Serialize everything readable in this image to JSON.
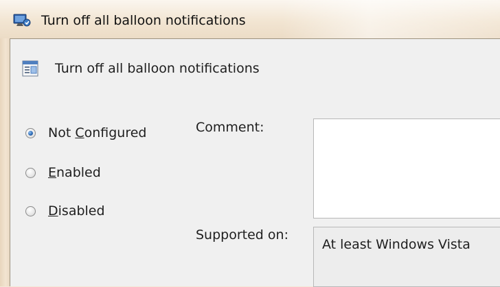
{
  "window": {
    "title": "Turn off all balloon notifications",
    "icon": "policy-window-icon"
  },
  "setting": {
    "title": "Turn off all balloon notifications",
    "icon": "policy-setting-icon"
  },
  "options": [
    {
      "pre": "Not ",
      "accel": "C",
      "post": "onfigured",
      "checked": true
    },
    {
      "pre": "",
      "accel": "E",
      "post": "nabled",
      "checked": false
    },
    {
      "pre": "",
      "accel": "D",
      "post": "isabled",
      "checked": false
    }
  ],
  "comment": {
    "label": "Comment:",
    "value": ""
  },
  "supported": {
    "label": "Supported on:",
    "value": "At least Windows Vista"
  },
  "colors": {
    "accent": "#2f6cb6",
    "dialog_bg": "#f0f0f0",
    "frame": "#f3e7d6"
  }
}
